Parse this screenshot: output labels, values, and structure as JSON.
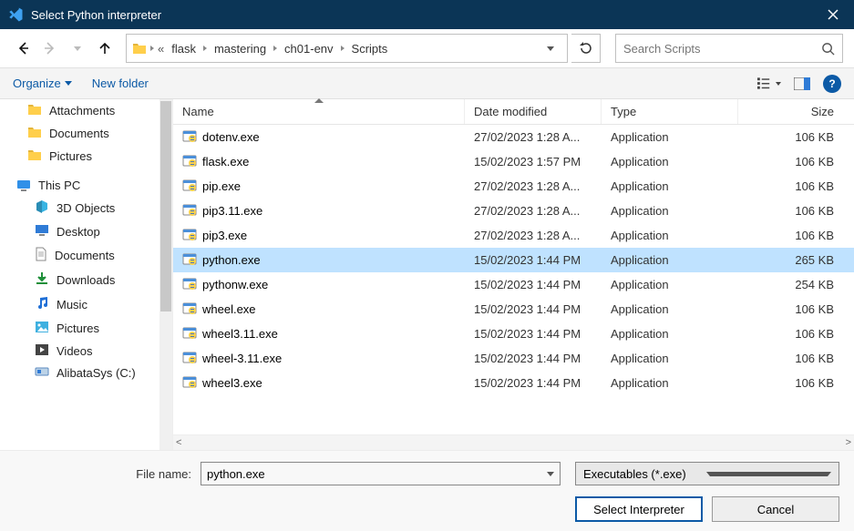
{
  "window": {
    "title": "Select Python interpreter"
  },
  "breadcrumb": {
    "segments": [
      {
        "label": "flask"
      },
      {
        "label": "mastering"
      },
      {
        "label": "ch01-env"
      },
      {
        "label": "Scripts"
      }
    ],
    "prefix_ellipsis": "«"
  },
  "search": {
    "placeholder": "Search Scripts"
  },
  "toolbar": {
    "organize": "Organize",
    "new_folder": "New folder"
  },
  "sidebar": {
    "quick_access": [
      {
        "label": "Attachments"
      },
      {
        "label": "Documents"
      },
      {
        "label": "Pictures"
      }
    ],
    "this_pc_label": "This PC",
    "this_pc": [
      {
        "label": "3D Objects"
      },
      {
        "label": "Desktop"
      },
      {
        "label": "Documents"
      },
      {
        "label": "Downloads"
      },
      {
        "label": "Music"
      },
      {
        "label": "Pictures"
      },
      {
        "label": "Videos"
      },
      {
        "label": "AlibataSys (C:)"
      }
    ]
  },
  "columns": {
    "name": "Name",
    "date": "Date modified",
    "type": "Type",
    "size": "Size"
  },
  "files": [
    {
      "name": "dotenv.exe",
      "date": "27/02/2023 1:28 A...",
      "type": "Application",
      "size": "106 KB",
      "selected": false
    },
    {
      "name": "flask.exe",
      "date": "15/02/2023 1:57 PM",
      "type": "Application",
      "size": "106 KB",
      "selected": false
    },
    {
      "name": "pip.exe",
      "date": "27/02/2023 1:28 A...",
      "type": "Application",
      "size": "106 KB",
      "selected": false
    },
    {
      "name": "pip3.11.exe",
      "date": "27/02/2023 1:28 A...",
      "type": "Application",
      "size": "106 KB",
      "selected": false
    },
    {
      "name": "pip3.exe",
      "date": "27/02/2023 1:28 A...",
      "type": "Application",
      "size": "106 KB",
      "selected": false
    },
    {
      "name": "python.exe",
      "date": "15/02/2023 1:44 PM",
      "type": "Application",
      "size": "265 KB",
      "selected": true
    },
    {
      "name": "pythonw.exe",
      "date": "15/02/2023 1:44 PM",
      "type": "Application",
      "size": "254 KB",
      "selected": false
    },
    {
      "name": "wheel.exe",
      "date": "15/02/2023 1:44 PM",
      "type": "Application",
      "size": "106 KB",
      "selected": false
    },
    {
      "name": "wheel3.11.exe",
      "date": "15/02/2023 1:44 PM",
      "type": "Application",
      "size": "106 KB",
      "selected": false
    },
    {
      "name": "wheel-3.11.exe",
      "date": "15/02/2023 1:44 PM",
      "type": "Application",
      "size": "106 KB",
      "selected": false
    },
    {
      "name": "wheel3.exe",
      "date": "15/02/2023 1:44 PM",
      "type": "Application",
      "size": "106 KB",
      "selected": false
    }
  ],
  "footer": {
    "file_name_label": "File name:",
    "file_name_value": "python.exe",
    "filter_label": "Executables (*.exe)",
    "primary_btn": "Select Interpreter",
    "cancel_btn": "Cancel"
  }
}
